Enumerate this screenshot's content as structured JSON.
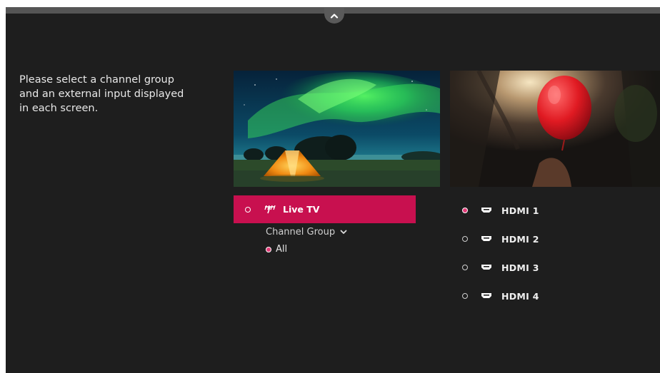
{
  "instruction": {
    "line1": "Please select a channel group",
    "line2": "and an external input displayed",
    "line3": "in each screen."
  },
  "previews": {
    "left_icon": "aurora-camping-image",
    "right_icon": "red-balloon-image"
  },
  "live_tv": {
    "label": "Live TV",
    "icon": "antenna-icon",
    "selected": true
  },
  "channel_group": {
    "label": "Channel Group",
    "icon": "chevron-down-icon",
    "options": [
      {
        "label": "All",
        "selected": true
      }
    ]
  },
  "inputs": [
    {
      "label": "HDMI 1",
      "icon": "hdmi-icon",
      "selected": true
    },
    {
      "label": "HDMI 2",
      "icon": "hdmi-icon",
      "selected": false
    },
    {
      "label": "HDMI 3",
      "icon": "hdmi-icon",
      "selected": false
    },
    {
      "label": "HDMI 4",
      "icon": "hdmi-icon",
      "selected": false
    }
  ],
  "colors": {
    "background": "#1e1e1e",
    "accent": "#c8104f",
    "selected_radio": "#e33b78"
  }
}
